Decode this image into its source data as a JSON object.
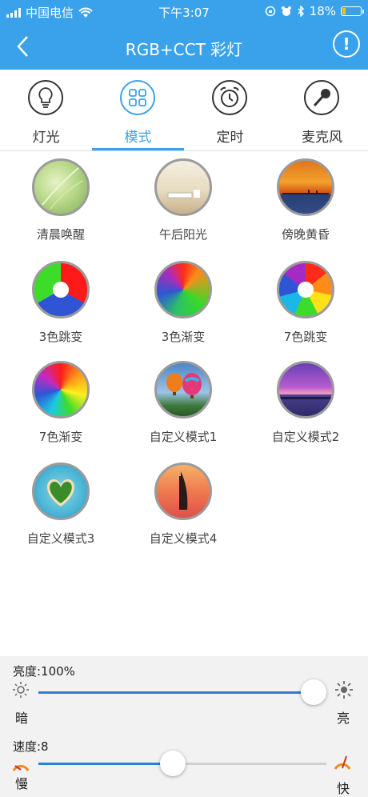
{
  "status_bar": {
    "carrier": "中国电信",
    "time": "下午3:07",
    "battery": "18%"
  },
  "header": {
    "title": "RGB+CCT 彩灯"
  },
  "tabs": [
    {
      "label": "灯光",
      "icon": "bulb-icon",
      "active": false
    },
    {
      "label": "模式",
      "icon": "grid-icon",
      "active": true
    },
    {
      "label": "定时",
      "icon": "alarm-clock-icon",
      "active": false
    },
    {
      "label": "麦克风",
      "icon": "microphone-icon",
      "active": false
    }
  ],
  "modes": [
    {
      "label": "清晨唤醒"
    },
    {
      "label": "午后阳光"
    },
    {
      "label": "傍晚黄昏"
    },
    {
      "label": "3色跳变"
    },
    {
      "label": "3色渐变"
    },
    {
      "label": "7色跳变"
    },
    {
      "label": "7色渐变"
    },
    {
      "label": "自定义模式1"
    },
    {
      "label": "自定义模式2"
    },
    {
      "label": "自定义模式3"
    },
    {
      "label": "自定义模式4"
    }
  ],
  "brightness": {
    "label": "亮度:100%",
    "value": 100,
    "min_label": "暗",
    "max_label": "亮"
  },
  "speed": {
    "label": "速度:8",
    "value": 8,
    "min_label": "慢",
    "max_label": "快"
  },
  "colors": {
    "accent": "#3aa2ea",
    "slider": "#2e7ed6"
  }
}
